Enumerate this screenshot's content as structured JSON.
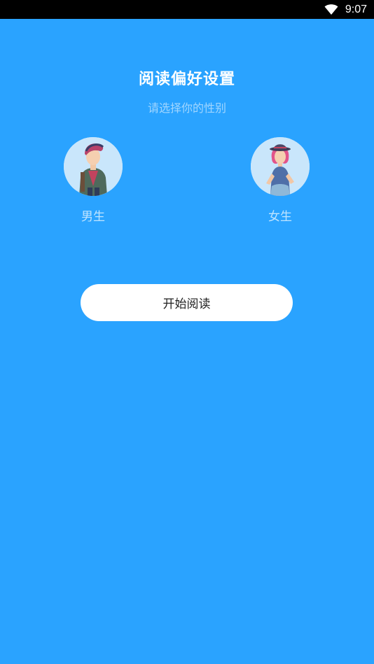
{
  "status_bar": {
    "time": "9:07",
    "wifi_icon": "wifi-icon"
  },
  "header": {
    "title": "阅读偏好设置",
    "subtitle": "请选择你的性别"
  },
  "gender_options": [
    {
      "label": "男生",
      "icon": "male-avatar-icon"
    },
    {
      "label": "女生",
      "icon": "female-avatar-icon"
    }
  ],
  "start_button": {
    "label": "开始阅读"
  },
  "colors": {
    "background": "#2aa3ff",
    "avatar_bg": "#c9e6fb",
    "button_bg": "#ffffff"
  }
}
